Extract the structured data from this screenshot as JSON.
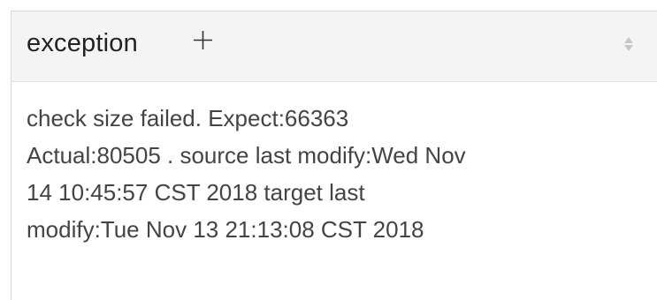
{
  "column": {
    "title": "exception",
    "add_icon": "plus-icon",
    "sort_icon": "sort-diamond-icon",
    "colors": {
      "header_background": "#f4f4f4",
      "text": "#444444",
      "title": "#222222",
      "icon_muted": "#c8c8c8"
    }
  },
  "cell": {
    "lines": [
      "check size failed. Expect:66363",
      "Actual:80505 . source last modify:Wed Nov",
      "14 10:45:57 CST 2018 target last",
      "modify:Tue Nov 13 21:13:08 CST 2018"
    ]
  }
}
